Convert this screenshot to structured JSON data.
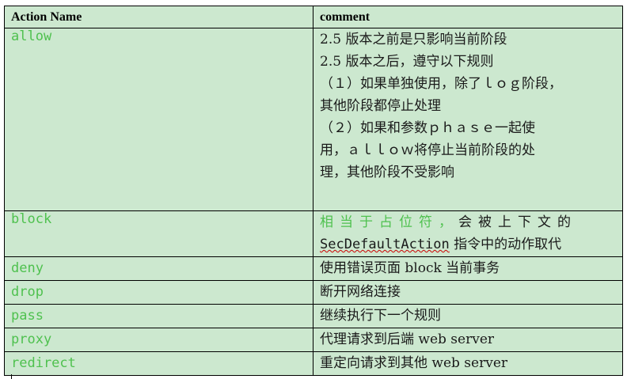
{
  "headers": {
    "name": "Action Name",
    "comment": "comment"
  },
  "rows": {
    "allow": {
      "name": "allow",
      "lines": [
        "2.5 版本之前是只影响当前阶段",
        "2.5 版本之后，遵守以下规则",
        "（１）如果单独使用，除了ｌｏｇ阶段，",
        "其他阶段都停止处理",
        "（２）如果和参数ｐｈａｓｅ一起使",
        "用，ａｌｌｏｗ将停止当前阶段的处",
        "理，其他阶段不受影响"
      ]
    },
    "block": {
      "name": "block",
      "line1_green": "相当于占位符，",
      "line1_rest": "会被上下文的",
      "line2_code": "SecDefaultAction",
      "line2_rest": " 指令中的动作取代"
    },
    "deny": {
      "name": "deny",
      "comment": "使用错误页面 block 当前事务"
    },
    "drop": {
      "name": "drop",
      "comment": "断开网络连接"
    },
    "pass": {
      "name": "pass",
      "comment": "继续执行下一个规则"
    },
    "proxy": {
      "name": "proxy",
      "comment": "代理请求到后端 web server"
    },
    "redirect": {
      "name": "redirect",
      "comment": "重定向请求到其他 web server"
    }
  }
}
